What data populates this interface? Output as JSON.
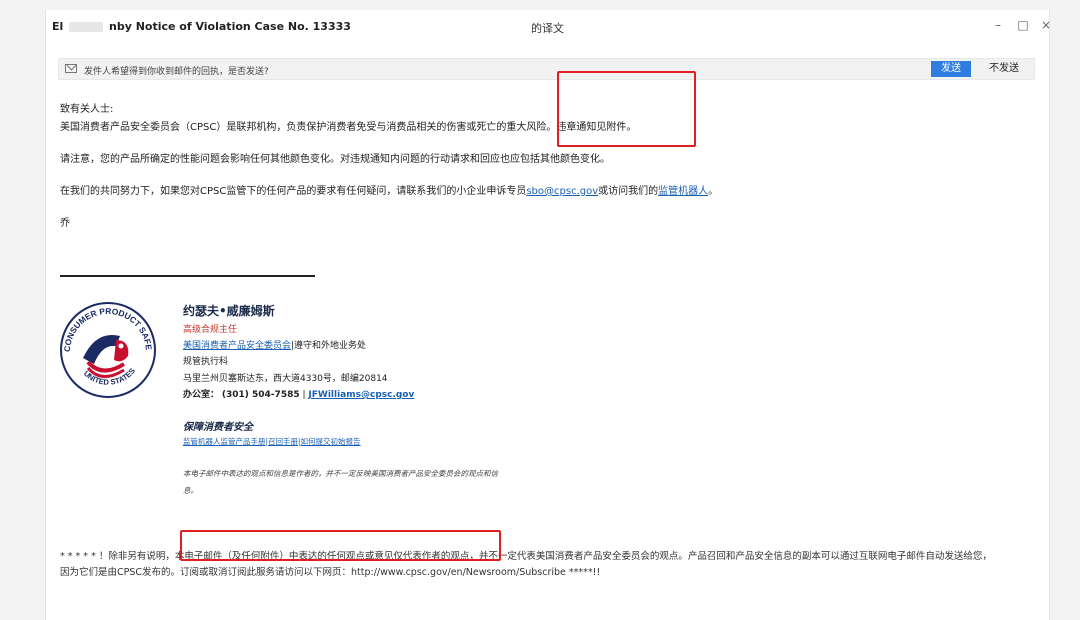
{
  "window": {
    "title_prefix": "El",
    "title_main": "nby Notice of Violation Case No. 13333",
    "title_suffix": "的译文",
    "minimize": "–",
    "maximize": "□",
    "close": "×"
  },
  "notice_bar": {
    "text": "发件人希望得到你收到邮件的回执，是否发送?",
    "send_label": "发送",
    "nosend_label": "不发送"
  },
  "email": {
    "greeting": "致有关人士:",
    "p1": "美国消费者产品安全委员会（CPSC）是联邦机构，负责保护消费者免受与消费品相关的伤害或死亡的重大风险。违章通知见附件。",
    "p2": "请注意，您的产品所确定的性能问题会影响任何其他颜色变化。对违规通知内问题的行动请求和回应也应包括其他颜色变化。",
    "p3_pre": "在我们的共同努力下，如果您对CPSC监管下的任何产品的要求有任何疑问，请联系我们的小企业申诉专员",
    "p3_email": "sbo@cpsc.gov",
    "p3_mid": "或访问我们的",
    "p3_link": "监管机器人",
    "p3_end": "。",
    "closing": "乔"
  },
  "signature": {
    "name": "约瑟夫•威廉姆斯",
    "role": "高级合规主任",
    "org_link": "美国消费者产品安全委员会",
    "org_rest": "|遵守和外地业务处",
    "dept": "规管执行科",
    "address": "马里兰州贝塞斯达东，西大道4330号，邮编20814",
    "office_label": "办公室：",
    "phone": "(301) 504-7585",
    "sep": "|",
    "email": "JFWilliams@cpsc.gov",
    "tagline": "保障消费者安全",
    "links": "监管机器人监管产品手册|召回手册|如何提交初始报告",
    "disclaimer_line1": "本电子邮件中表达的观点和信息是作者的，并不一定反映美国消费者产品安全委员会的观点和信",
    "disclaimer_line2": "息。",
    "seal_top": "CONSUMER PRODUCT SAFETY COMMISSION",
    "seal_bottom": "UNITED STATES"
  },
  "footer": {
    "line1_a": "* * * * * ！除非另有说明，",
    "line1_b": "本电子邮件（及任何附件）中表达的任何观点或意见仅代表作者的观点，",
    "line1_c": "并不一定代表美国消费者产品安全委员会的观点。产品召回和产品安全信息的副本可以通过互联网电子邮件自动发送给您，",
    "line2": "因为它们是由CPSC发布的。订阅或取消订阅此服务请访问以下网页：http://www.cpsc.gov/en/Newsroom/Subscribe *****!!"
  },
  "colors": {
    "accent_blue": "#2f7de1",
    "annotation_red": "#e02020",
    "seal_navy": "#1b2a63",
    "seal_red": "#c8102e"
  }
}
